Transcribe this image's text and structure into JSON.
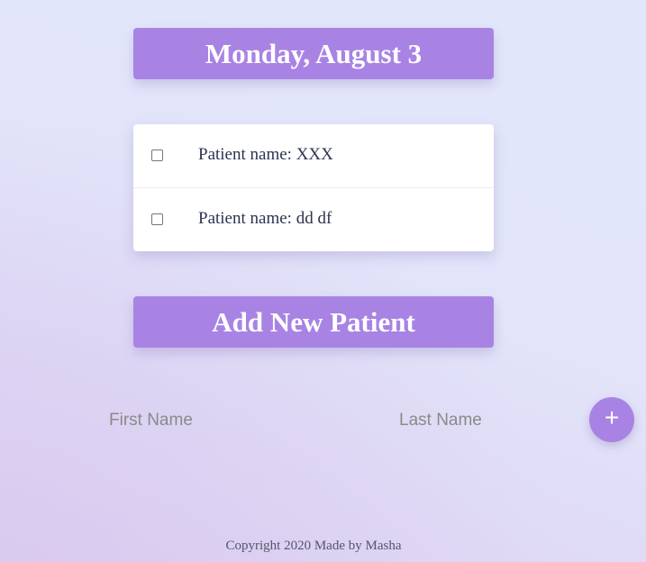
{
  "header": {
    "date_title": "Monday, August 3"
  },
  "patients": [
    {
      "label": "Patient name: XXX",
      "checked": false
    },
    {
      "label": "Patient name: dd df",
      "checked": false
    }
  ],
  "add_section": {
    "title": "Add New Patient",
    "first_name_placeholder": "First Name",
    "last_name_placeholder": "Last Name",
    "add_button_icon": "plus-icon",
    "add_button_glyph": "+"
  },
  "footer": {
    "text": "Copyright 2020 Made by Masha"
  },
  "colors": {
    "accent": "#a883e4",
    "background_start": "#e2e6fb",
    "background_end": "#ddd0f1",
    "card": "#ffffff",
    "text": "#2d3350"
  }
}
